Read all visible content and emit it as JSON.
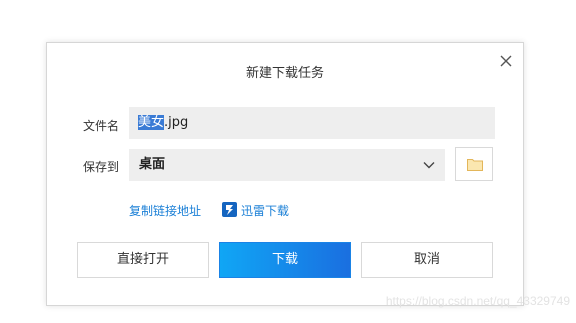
{
  "dialog": {
    "title": "新建下载任务"
  },
  "filename": {
    "label": "文件名",
    "selected_part": "美女",
    "rest": ".jpg"
  },
  "save_to": {
    "label": "保存到",
    "value": "桌面"
  },
  "links": {
    "copy_link": "复制链接地址",
    "xunlei": "迅雷下载"
  },
  "buttons": {
    "open_directly": "直接打开",
    "download": "下载",
    "cancel": "取消"
  },
  "watermark": "https://blog.csdn.net/qq_43329749",
  "icons": {
    "close": "close-icon",
    "dropdown": "chevron-down-icon",
    "folder": "folder-icon",
    "xunlei": "xunlei-icon"
  },
  "colors": {
    "accent": "#1a7fd6",
    "primary_button_start": "#10a6f5",
    "primary_button_end": "#1a6fe0",
    "field_bg": "#eeeeee"
  }
}
